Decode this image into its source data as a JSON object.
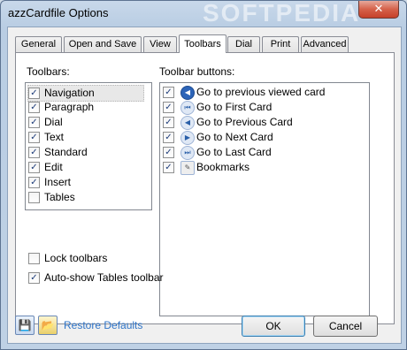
{
  "window": {
    "title": "azzCardfile Options",
    "close_glyph": "✕",
    "watermark": "SOFTPEDIA"
  },
  "tabs": [
    {
      "label": "General"
    },
    {
      "label": "Open and Save"
    },
    {
      "label": "View"
    },
    {
      "label": "Toolbars",
      "active": true
    },
    {
      "label": "Dial"
    },
    {
      "label": "Print"
    },
    {
      "label": "Advanced"
    }
  ],
  "toolbars": {
    "label": "Toolbars:",
    "items": [
      {
        "label": "Navigation",
        "checked": true,
        "selected": true
      },
      {
        "label": "Paragraph",
        "checked": true
      },
      {
        "label": "Dial",
        "checked": true
      },
      {
        "label": "Text",
        "checked": true
      },
      {
        "label": "Standard",
        "checked": true
      },
      {
        "label": "Edit",
        "checked": true
      },
      {
        "label": "Insert",
        "checked": true
      },
      {
        "label": "Tables",
        "checked": false
      }
    ]
  },
  "toolbar_buttons": {
    "label": "Toolbar buttons:",
    "items": [
      {
        "label": "Go to previous viewed card",
        "checked": true,
        "icon": "back-arrow-icon"
      },
      {
        "label": "Go to First Card",
        "checked": true,
        "icon": "first-card-icon"
      },
      {
        "label": "Go to Previous Card",
        "checked": true,
        "icon": "previous-card-icon"
      },
      {
        "label": "Go to Next Card",
        "checked": true,
        "icon": "next-card-icon"
      },
      {
        "label": "Go to Last Card",
        "checked": true,
        "icon": "last-card-icon"
      },
      {
        "label": "Bookmarks",
        "checked": true,
        "icon": "bookmarks-icon"
      }
    ]
  },
  "options": {
    "lock_toolbars": {
      "label": "Lock toolbars",
      "checked": false
    },
    "auto_show_tables": {
      "label": "Auto-show Tables toolbar",
      "checked": true
    }
  },
  "footer": {
    "restore_defaults": "Restore Defaults",
    "ok": "OK",
    "cancel": "Cancel",
    "save_icon": "save-icon",
    "open_icon": "open-folder-icon"
  },
  "colors": {
    "accent": "#2e74c8",
    "title_bar": "#bfd1e5",
    "close": "#c6402a"
  }
}
